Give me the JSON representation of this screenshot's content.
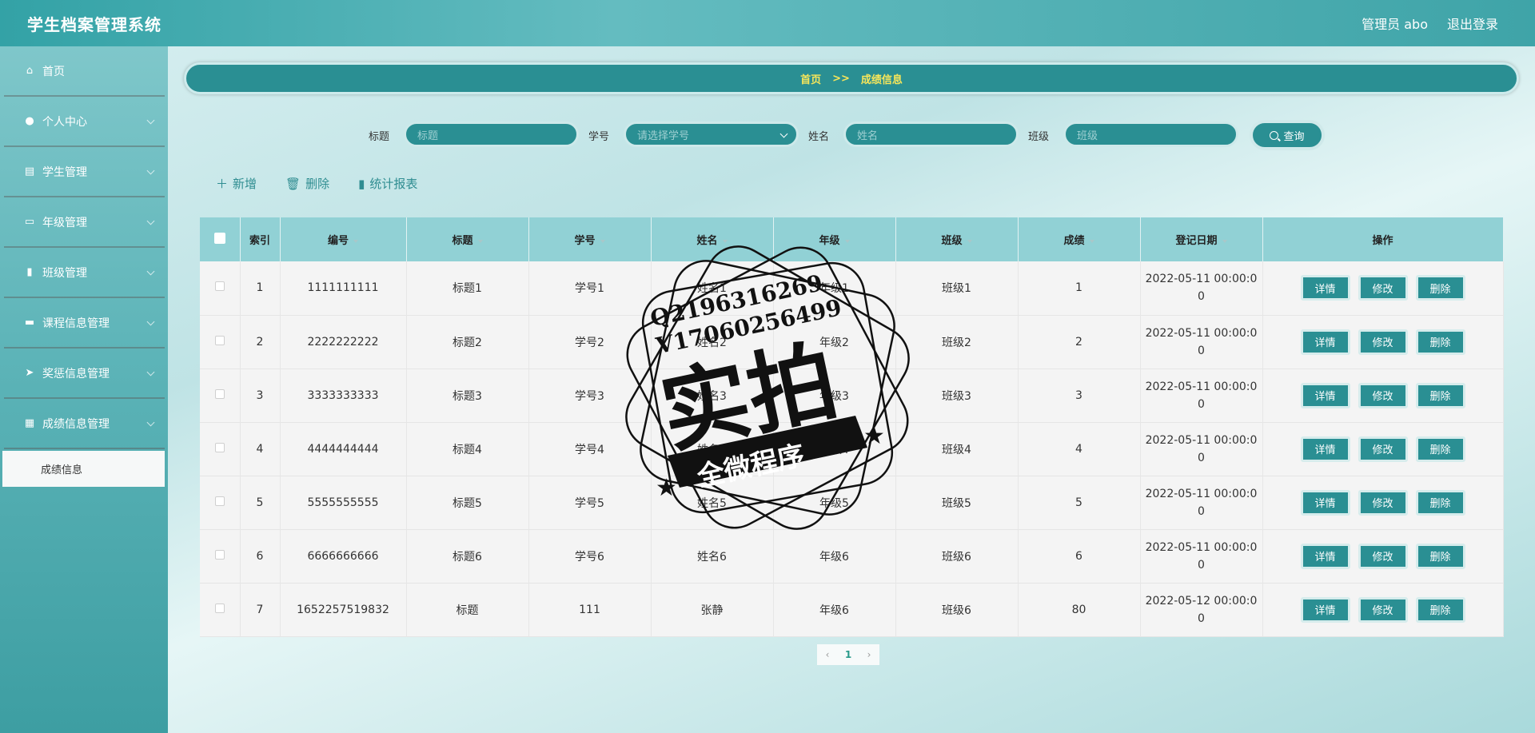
{
  "header": {
    "app_title": "学生档案管理系统",
    "user_label": "管理员 abo",
    "logout_label": "退出登录"
  },
  "sidebar": {
    "items": [
      {
        "label": "首页",
        "icon": "home-icon",
        "glyph": "⌂"
      },
      {
        "label": "个人中心",
        "icon": "user-icon",
        "glyph": "●"
      },
      {
        "label": "学生管理",
        "icon": "clipboard-icon",
        "glyph": "▤"
      },
      {
        "label": "年级管理",
        "icon": "briefcase-icon",
        "glyph": "▭"
      },
      {
        "label": "班级管理",
        "icon": "bar-chart-icon",
        "glyph": "▮"
      },
      {
        "label": "课程信息管理",
        "icon": "card-icon",
        "glyph": "▬"
      },
      {
        "label": "奖惩信息管理",
        "icon": "send-icon",
        "glyph": "➤"
      },
      {
        "label": "成绩信息管理",
        "icon": "grid-icon",
        "glyph": "▦"
      }
    ],
    "submenu_item": "成绩信息"
  },
  "breadcrumb": {
    "home": "首页",
    "separator": ">>",
    "current": "成绩信息"
  },
  "search": {
    "title_label": "标题",
    "title_placeholder": "标题",
    "student_no_label": "学号",
    "student_no_placeholder": "请选择学号",
    "name_label": "姓名",
    "name_placeholder": "姓名",
    "class_label": "班级",
    "class_placeholder": "班级",
    "button_label": "查询"
  },
  "toolbar": {
    "add_label": "新增",
    "delete_label": "删除",
    "report_label": "统计报表"
  },
  "table": {
    "headers": [
      "索引",
      "编号",
      "标题",
      "学号",
      "姓名",
      "年级",
      "班级",
      "成绩",
      "登记日期",
      "操作"
    ],
    "rows": [
      {
        "index": "1",
        "no": "1111111111",
        "title": "标题1",
        "student_no": "学号1",
        "name": "姓名1",
        "grade": "年级1",
        "class": "班级1",
        "score": "1",
        "date1": "2022-05-11 00:00:0",
        "date2": "0"
      },
      {
        "index": "2",
        "no": "2222222222",
        "title": "标题2",
        "student_no": "学号2",
        "name": "姓名2",
        "grade": "年级2",
        "class": "班级2",
        "score": "2",
        "date1": "2022-05-11 00:00:0",
        "date2": "0"
      },
      {
        "index": "3",
        "no": "3333333333",
        "title": "标题3",
        "student_no": "学号3",
        "name": "姓名3",
        "grade": "年级3",
        "class": "班级3",
        "score": "3",
        "date1": "2022-05-11 00:00:0",
        "date2": "0"
      },
      {
        "index": "4",
        "no": "4444444444",
        "title": "标题4",
        "student_no": "学号4",
        "name": "姓名4",
        "grade": "年级4",
        "class": "班级4",
        "score": "4",
        "date1": "2022-05-11 00:00:0",
        "date2": "0"
      },
      {
        "index": "5",
        "no": "5555555555",
        "title": "标题5",
        "student_no": "学号5",
        "name": "姓名5",
        "grade": "年级5",
        "class": "班级5",
        "score": "5",
        "date1": "2022-05-11 00:00:0",
        "date2": "0"
      },
      {
        "index": "6",
        "no": "6666666666",
        "title": "标题6",
        "student_no": "学号6",
        "name": "姓名6",
        "grade": "年级6",
        "class": "班级6",
        "score": "6",
        "date1": "2022-05-11 00:00:0",
        "date2": "0"
      },
      {
        "index": "7",
        "no": "1652257519832",
        "title": "标题",
        "student_no": "111",
        "name": "张静",
        "grade": "年级6",
        "class": "班级6",
        "score": "80",
        "date1": "2022-05-12 00:00:0",
        "date2": "0"
      }
    ],
    "actions": {
      "detail": "详情",
      "edit": "修改",
      "delete": "删除"
    }
  },
  "pagination": {
    "prev": "‹",
    "current": "1",
    "next": "›"
  },
  "watermark": {
    "line1": "Q2196316269",
    "line2": "V17060256499",
    "main": "实拍",
    "banner": "全微程序"
  },
  "colors": {
    "accent": "#2a8f93",
    "header_row": "#91d1d5",
    "breadcrumb_text": "#f7e65a"
  }
}
